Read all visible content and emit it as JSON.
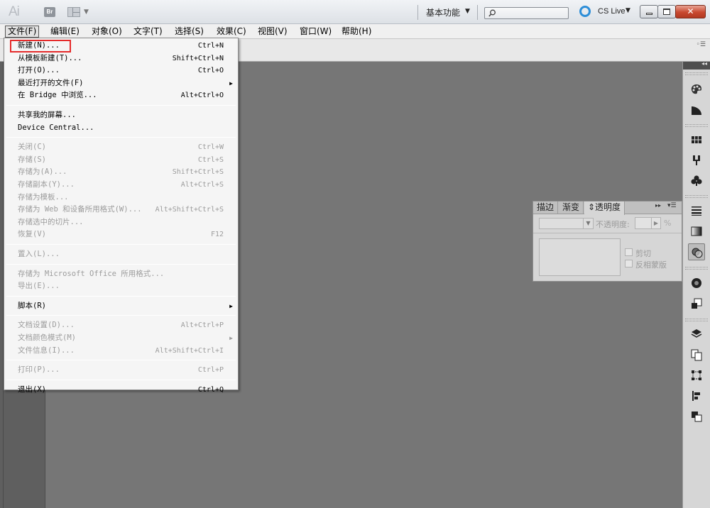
{
  "app": {
    "logo": "Ai",
    "bridge_label": "Br",
    "workspace": "基本功能",
    "cslive": "CS Live",
    "close_glyph": "✕"
  },
  "menubar": [
    {
      "label": "文件(F)",
      "active": true
    },
    {
      "label": "编辑(E)"
    },
    {
      "label": "对象(O)"
    },
    {
      "label": "文字(T)"
    },
    {
      "label": "选择(S)"
    },
    {
      "label": "效果(C)"
    },
    {
      "label": "视图(V)"
    },
    {
      "label": "窗口(W)"
    },
    {
      "label": "帮助(H)"
    }
  ],
  "file_menu": [
    {
      "label": "新建(N)...",
      "shortcut": "Ctrl+N",
      "enabled": true
    },
    {
      "label": "从模板新建(T)...",
      "shortcut": "Shift+Ctrl+N",
      "enabled": true
    },
    {
      "label": "打开(O)...",
      "shortcut": "Ctrl+O",
      "enabled": true
    },
    {
      "label": "最近打开的文件(F)",
      "shortcut": "",
      "enabled": true,
      "submenu": true
    },
    {
      "label": "在 Bridge 中浏览...",
      "shortcut": "Alt+Ctrl+O",
      "enabled": true
    },
    {
      "sep": true
    },
    {
      "label": "共享我的屏幕...",
      "shortcut": "",
      "enabled": true
    },
    {
      "label": "Device Central...",
      "shortcut": "",
      "enabled": true
    },
    {
      "sep": true
    },
    {
      "label": "关闭(C)",
      "shortcut": "Ctrl+W",
      "enabled": false
    },
    {
      "label": "存储(S)",
      "shortcut": "Ctrl+S",
      "enabled": false
    },
    {
      "label": "存储为(A)...",
      "shortcut": "Shift+Ctrl+S",
      "enabled": false
    },
    {
      "label": "存储副本(Y)...",
      "shortcut": "Alt+Ctrl+S",
      "enabled": false
    },
    {
      "label": "存储为模板...",
      "shortcut": "",
      "enabled": false
    },
    {
      "label": "存储为 Web 和设备所用格式(W)...",
      "shortcut": "Alt+Shift+Ctrl+S",
      "enabled": false
    },
    {
      "label": "存储选中的切片...",
      "shortcut": "",
      "enabled": false
    },
    {
      "label": "恢复(V)",
      "shortcut": "F12",
      "enabled": false
    },
    {
      "sep": true
    },
    {
      "label": "置入(L)...",
      "shortcut": "",
      "enabled": false
    },
    {
      "sep": true
    },
    {
      "label": "存储为 Microsoft Office 所用格式...",
      "shortcut": "",
      "enabled": false
    },
    {
      "label": "导出(E)...",
      "shortcut": "",
      "enabled": false
    },
    {
      "sep": true
    },
    {
      "label": "脚本(R)",
      "shortcut": "",
      "enabled": true,
      "submenu": true
    },
    {
      "sep": true
    },
    {
      "label": "文档设置(D)...",
      "shortcut": "Alt+Ctrl+P",
      "enabled": false
    },
    {
      "label": "文档颜色模式(M)",
      "shortcut": "",
      "enabled": false,
      "submenu": true
    },
    {
      "label": "文件信息(I)...",
      "shortcut": "Alt+Shift+Ctrl+I",
      "enabled": false
    },
    {
      "sep": true
    },
    {
      "label": "打印(P)...",
      "shortcut": "Ctrl+P",
      "enabled": false
    },
    {
      "sep": true
    },
    {
      "label": "退出(X)",
      "shortcut": "Ctrl+Q",
      "enabled": true
    }
  ],
  "panel": {
    "tabs": [
      "描边",
      "渐变",
      "⇕透明度"
    ],
    "active_tab": 2,
    "opacity_label": "不透明度:",
    "opacity_unit": "%",
    "clip_label": "剪切",
    "invert_label": "反相蒙版"
  },
  "colors": {
    "highlight": "#e52a2a",
    "cslive": "#2d8ed8"
  }
}
